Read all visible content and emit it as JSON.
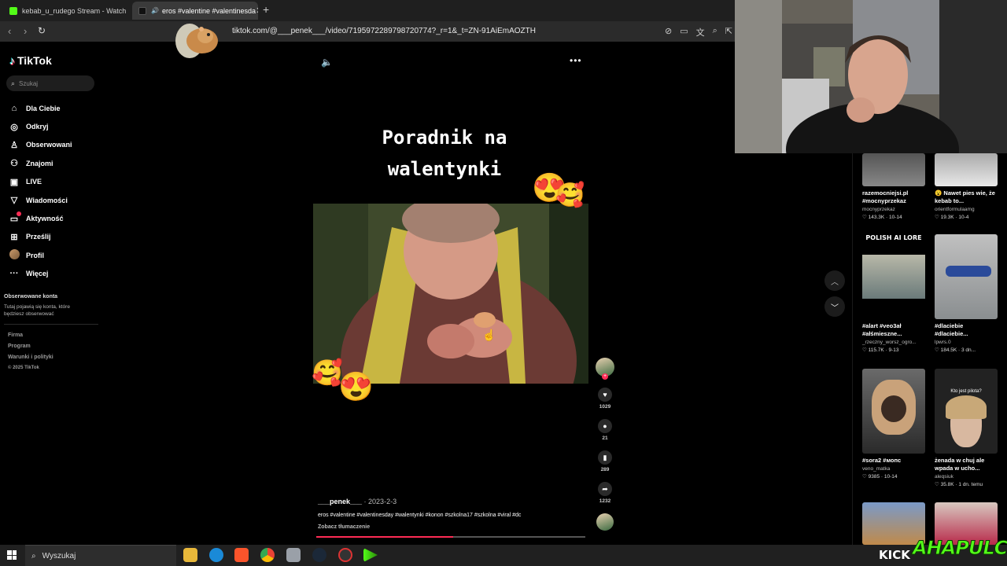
{
  "browser": {
    "tabs": [
      {
        "title": "kebab_u_rudego Stream - Watch",
        "active": false,
        "favicon_color": "#53fc18"
      },
      {
        "title": "eros #valentine #valentinesda",
        "active": true,
        "favicon_color": "#111111"
      }
    ],
    "url": "tiktok.com/@___penek___/video/7195972289798720774?_r=1&_t=ZN-91AiEmAOZTH"
  },
  "tiktok": {
    "logo": "TikTok",
    "search_placeholder": "Szukaj",
    "nav": [
      {
        "label": "Dla Ciebie",
        "icon": "home-icon"
      },
      {
        "label": "Odkryj",
        "icon": "compass-icon"
      },
      {
        "label": "Obserwowani",
        "icon": "following-icon"
      },
      {
        "label": "Znajomi",
        "icon": "friends-icon"
      },
      {
        "label": "LIVE",
        "icon": "live-icon"
      },
      {
        "label": "Wiadomości",
        "icon": "messages-icon"
      },
      {
        "label": "Aktywność",
        "icon": "activity-icon"
      },
      {
        "label": "Prześlij",
        "icon": "upload-icon"
      },
      {
        "label": "Profil",
        "icon": "profile-avatar"
      },
      {
        "label": "Więcej",
        "icon": "more-icon"
      }
    ],
    "followed_title": "Obserwowane konta",
    "followed_text": "Tutaj pojawią się konta, które będziesz obserwować",
    "footer": [
      "Firma",
      "Program",
      "Warunki i polityki",
      "© 2025 TikTok"
    ]
  },
  "video": {
    "title_line1": "Poradnik na",
    "title_line2": "walentynki",
    "author": "___penek___",
    "date": " · 2023-2-3",
    "description": "eros #valentine #valentinesday #walentynki #konon #szkolna17 #szkolna #viral #dc",
    "translate": "Zobacz tłumaczenie",
    "progress": 0.51,
    "likes": "1029",
    "comments": "21",
    "saves": "289",
    "shares": "1232"
  },
  "recommendations": [
    {
      "title": "razemocniejsi.pl #mocnyprzekaz",
      "user": "mocnyprzekaz",
      "meta": "♡ 143.3K · 10-14"
    },
    {
      "title": "😮 Nawet pies wie, że kebab to...",
      "user": "orientformulaamg",
      "meta": "♡ 19.3K · 10-4"
    },
    {
      "title": "#alart #veo3ał #ałśmieszne...",
      "user": "_rzeczny_worsz_ogro...",
      "meta": "♡ 115.7K · 9-13"
    },
    {
      "title": "#dlaciebie #dlaciebie...",
      "user": "lpwrs.0",
      "meta": "♡ 184.5K · 3 dn..."
    },
    {
      "title": "#sora2 #мопс",
      "user": "veno_matka",
      "meta": "♡ 9385 · 10-14"
    },
    {
      "title": "żenada w chuj ale wpada w ucho...",
      "user": "aleqsiuk",
      "meta": "♡ 35.8K · 1 dn. temu"
    }
  ],
  "rec_thumb_texts": {
    "polish": "POLISH AI LORE",
    "pilot": "Kto jest pilota?"
  },
  "taskbar": {
    "search": "Wyszukaj"
  },
  "overlay": {
    "kick": "KICK",
    "brand": "AHAPULCO"
  }
}
